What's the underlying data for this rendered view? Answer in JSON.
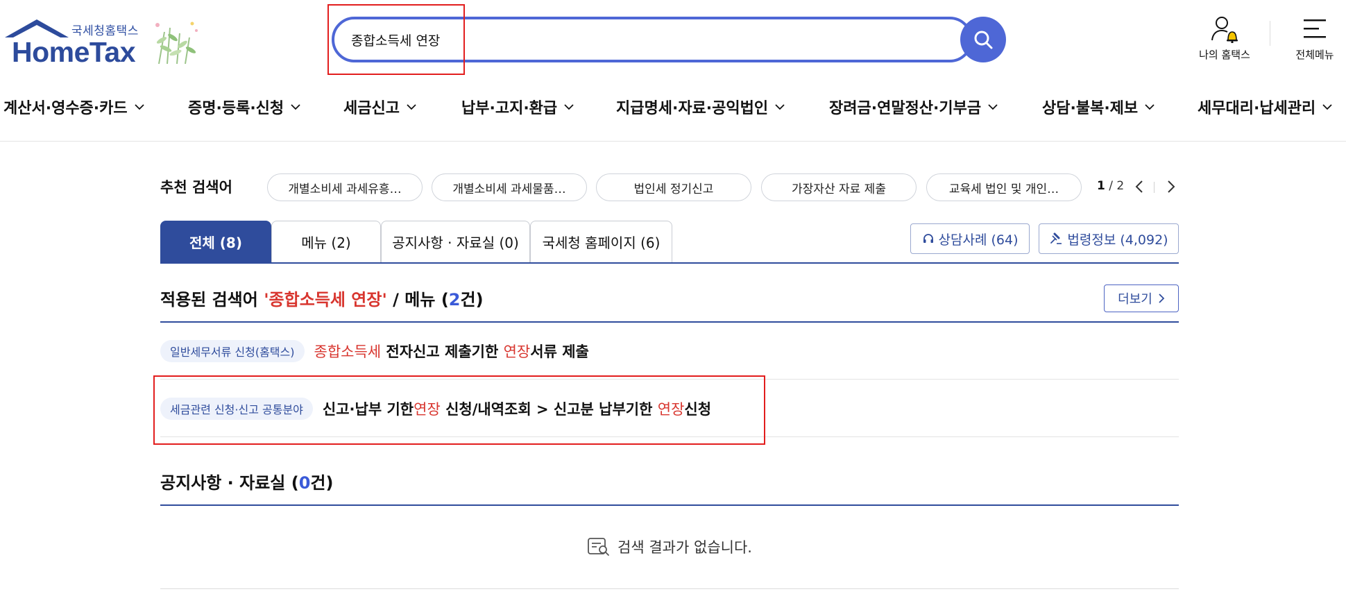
{
  "header": {
    "logo_small": "국세청홈택스",
    "logo_main": "HomeTax",
    "search_value": "종합소득세 연장",
    "my_hometax_label": "나의 홈택스",
    "all_menu_label": "전체메뉴"
  },
  "gnb": {
    "items": [
      "계산서·영수증·카드",
      "증명·등록·신청",
      "세금신고",
      "납부·고지·환급",
      "지급명세·자료·공익법인",
      "장려금·연말정산·기부금",
      "상담·불복·제보",
      "세무대리·납세관리"
    ]
  },
  "recommend": {
    "label": "추천 검색어",
    "chips": [
      "개별소비세 과세유흥…",
      "개별소비세 과세물품…",
      "법인세 정기신고",
      "가장자산 자료 제출",
      "교육세 법인 및 개인…"
    ],
    "page_current": "1",
    "page_total": "/ 2"
  },
  "tabs": [
    {
      "label": "전체 (8)",
      "active": true
    },
    {
      "label": "메뉴 (2)",
      "active": false
    },
    {
      "label": "공지사항 · 자료실 (0)",
      "active": false
    },
    {
      "label": "국세청 홈페이지 (6)",
      "active": false
    }
  ],
  "side_buttons": {
    "consult": "상담사례 (64)",
    "law": "법령정보 (4,092)"
  },
  "menu_section": {
    "prefix": "적용된 검색어 ",
    "query": "'종합소득세 연장'",
    "middle": " / 메뉴 (",
    "count": "2",
    "suffix": "건)",
    "more_label": "더보기"
  },
  "results": [
    {
      "badge": "일반세무서류 신청(홈택스)",
      "parts": [
        {
          "text": "종합소득세",
          "hl": true
        },
        {
          "text": " 전자신고 제출기한 ",
          "hl": false
        },
        {
          "text": "연장",
          "hl": true
        },
        {
          "text": "서류 제출",
          "hl": false
        }
      ]
    },
    {
      "badge": "세금관련 신청·신고 공통분야",
      "parts": [
        {
          "text": "신고·납부 기한",
          "hl": false
        },
        {
          "text": "연장",
          "hl": true
        },
        {
          "text": " 신청/내역조회 > 신고분 납부기한 ",
          "hl": false
        },
        {
          "text": "연장",
          "hl": true
        },
        {
          "text": "신청",
          "hl": false
        }
      ]
    }
  ],
  "notice_section": {
    "prefix": "공지사항 · 자료실 (",
    "count": "0",
    "suffix": "건)",
    "empty_text": "검색 결과가 없습니다."
  },
  "colors": {
    "brand_blue": "#2f4c9c",
    "search_blue": "#4e67d6",
    "highlight_red": "#d8352e",
    "annotation_red": "#e21d1d"
  }
}
